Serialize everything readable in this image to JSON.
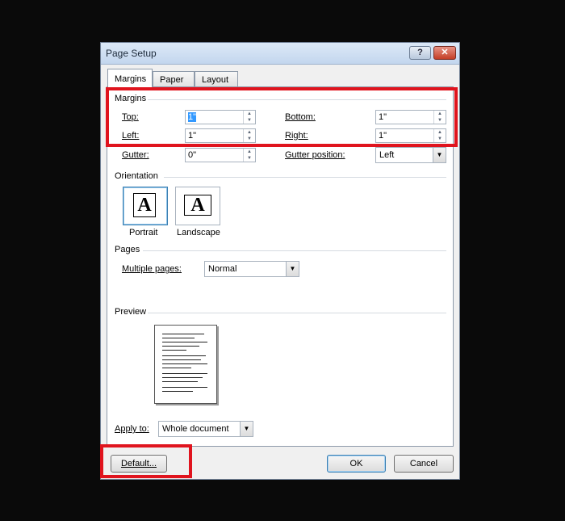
{
  "window": {
    "title": "Page Setup",
    "help_label": "?",
    "close_label": "✕"
  },
  "tabs": [
    {
      "label": "Margins",
      "active": true
    },
    {
      "label": "Paper"
    },
    {
      "label": "Layout"
    }
  ],
  "margins": {
    "section": "Margins",
    "top": {
      "label": "Top:",
      "value": "1\""
    },
    "bottom": {
      "label": "Bottom:",
      "value": "1\""
    },
    "left": {
      "label": "Left:",
      "value": "1\""
    },
    "right": {
      "label": "Right:",
      "value": "1\""
    },
    "gutter": {
      "label": "Gutter:",
      "value": "0\""
    },
    "gutter_position": {
      "label": "Gutter position:",
      "value": "Left"
    }
  },
  "orientation": {
    "section": "Orientation",
    "portrait_label": "Portrait",
    "landscape_label": "Landscape",
    "glyph": "A",
    "selected": "portrait"
  },
  "pages": {
    "section": "Pages",
    "multiple_label": "Multiple pages:",
    "multiple_value": "Normal"
  },
  "preview": {
    "section": "Preview"
  },
  "apply": {
    "label": "Apply to:",
    "value": "Whole document"
  },
  "footer": {
    "default_label": "Default...",
    "ok_label": "OK",
    "cancel_label": "Cancel"
  },
  "colors": {
    "highlight_box": "#e0141e",
    "accent": "#3399ff"
  },
  "icons": {
    "spin_up": "▲",
    "spin_down": "▼",
    "dropdown": "▼"
  }
}
